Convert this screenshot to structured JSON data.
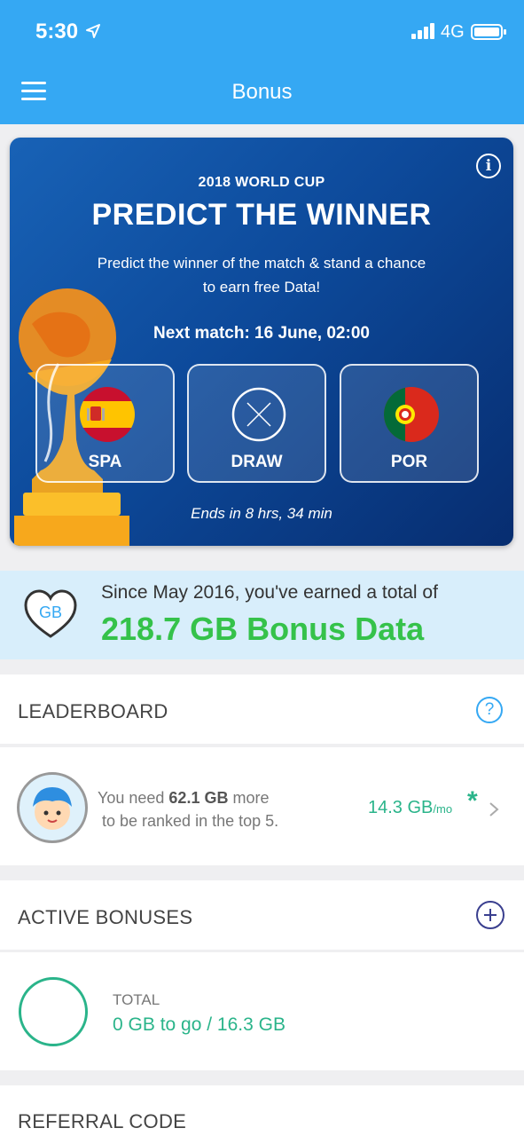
{
  "status_bar": {
    "time": "5:30",
    "network": "4G"
  },
  "nav": {
    "title": "Bonus"
  },
  "promo": {
    "eyebrow": "2018 WORLD CUP",
    "title": "PREDICT THE WINNER",
    "description": "Predict the winner of the match & stand a chance to earn free Data!",
    "next_match": "Next match: 16 June, 02:00",
    "choices": [
      {
        "label": "SPA",
        "icon": "spain-flag-icon"
      },
      {
        "label": "DRAW",
        "icon": "draw-x-icon"
      },
      {
        "label": "POR",
        "icon": "portugal-flag-icon"
      }
    ],
    "ends": "Ends in 8 hrs, 34 min"
  },
  "bonus": {
    "badge": "GB",
    "line1": "Since May 2016, you've earned a total of",
    "total": "218.7 GB Bonus Data"
  },
  "leaderboard": {
    "title": "LEADERBOARD",
    "help": "?",
    "message_prefix": "You need ",
    "message_amount": "62.1 GB",
    "message_suffix": " more",
    "message_line2": "to be ranked in the top 5.",
    "rate_value": "14.3 GB",
    "rate_unit": "/mo",
    "asterisk": "*"
  },
  "active_bonuses": {
    "title": "ACTIVE BONUSES",
    "total_label": "TOTAL",
    "total_value": "0 GB to go / 16.3 GB"
  },
  "referral": {
    "title": "REFERRAL CODE"
  },
  "colors": {
    "header_blue": "#35a8f3",
    "promo_blue": "#0d4a9b",
    "bonus_green": "#35c24a",
    "teal": "#2ab48a"
  }
}
